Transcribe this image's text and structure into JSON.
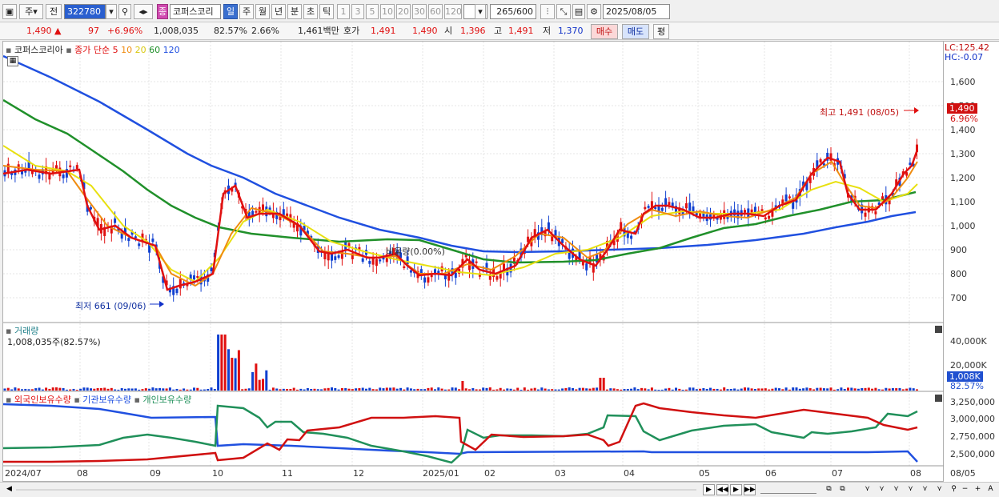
{
  "toolbar": {
    "mode_label": "주",
    "prev_label": "전",
    "stock_code": "322780",
    "search_icon": "search-icon",
    "stock_badge": "종",
    "stock_name": "코퍼스코리",
    "periods": [
      "일",
      "주",
      "월",
      "년",
      "분",
      "초",
      "틱"
    ],
    "intervals": [
      "1",
      "3",
      "5",
      "10",
      "20",
      "30",
      "60",
      "120"
    ],
    "count": "265",
    "count_total": "/600",
    "date": "2025/08/05"
  },
  "quote": {
    "price": "1,490",
    "change": "97",
    "change_pct": "+6.96%",
    "volume": "1,008,035",
    "vol_ratio": "82.57%",
    "turnover": "2.66%",
    "amount": "1,461백만",
    "ask_label": "호가",
    "ask": "1,491",
    "bid": "1,490",
    "open_label": "시",
    "open": "1,396",
    "high_label": "고",
    "high": "1,491",
    "low_label": "저",
    "low": "1,370",
    "buy_label": "매수",
    "sell_label": "매도",
    "avg_label": "평"
  },
  "price_pane": {
    "title_name": "코퍼스코리아",
    "title_ma": "종가 단순",
    "ma_periods": [
      "5",
      "10",
      "20",
      "60",
      "120"
    ],
    "ma_colors": [
      "#e01010",
      "#f08c10",
      "#e8e010",
      "#20902a",
      "#2050e0"
    ],
    "lc": "LC:125.42",
    "hc": "HC:-0.07",
    "max_annotation": "최고 1,491 (08/05)",
    "min_annotation": "최저 661 (09/06)",
    "ratio_annotation": "비율량(0.00%)",
    "price_tag": "1,490",
    "pct_tag": "6.96%",
    "y_ticks": [
      "1,600",
      "1,500",
      "1,400",
      "1,300",
      "1,200",
      "1,100",
      "1,000",
      "900",
      "800",
      "700"
    ]
  },
  "volume_pane": {
    "title": "거래량",
    "value": "1,008,035주(82.57%)",
    "y_ticks": [
      "40,000K",
      "20,000K"
    ],
    "tag": "1,008K",
    "pct": "82.57%"
  },
  "holding_pane": {
    "title_foreign": "외국인보유수량",
    "title_inst": "기관보유수량",
    "title_indiv": "개인보유수량",
    "y_ticks": [
      "3,250,000",
      "3,000,000",
      "2,750,000",
      "2,500,000"
    ]
  },
  "x_axis": [
    "2024/07",
    "08",
    "09",
    "10",
    "11",
    "12",
    "2025/01",
    "02",
    "03",
    "04",
    "05",
    "06",
    "07",
    "08",
    "08/05"
  ]
}
